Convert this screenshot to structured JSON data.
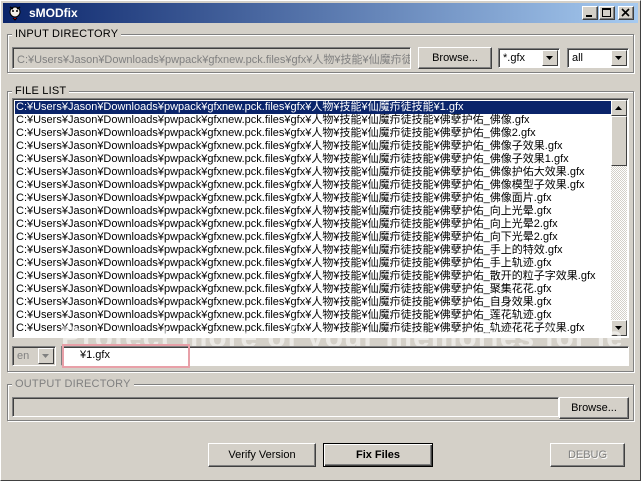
{
  "window": {
    "title": "sMODfix"
  },
  "input_directory": {
    "label": "INPUT DIRECTORY",
    "path": "C:¥Users¥Jason¥Downloads¥pwpack¥gfxnew.pck.files¥gfx¥人物¥技能¥仙魔疖徒技",
    "browse_label": "Browse...",
    "filter_value": "*.gfx",
    "scope_value": "all"
  },
  "file_list": {
    "label": "FILE LIST",
    "items": [
      "C:¥Users¥Jason¥Downloads¥pwpack¥gfxnew.pck.files¥gfx¥人物¥技能¥仙魔疖徒技能¥1.gfx",
      "C:¥Users¥Jason¥Downloads¥pwpack¥gfxnew.pck.files¥gfx¥人物¥技能¥仙魔疖徒技能¥佛孽护佑_佛像.gfx",
      "C:¥Users¥Jason¥Downloads¥pwpack¥gfxnew.pck.files¥gfx¥人物¥技能¥仙魔疖徒技能¥佛孽护佑_佛像2.gfx",
      "C:¥Users¥Jason¥Downloads¥pwpack¥gfxnew.pck.files¥gfx¥人物¥技能¥仙魔疖徒技能¥佛孽护佑_佛像子效果.gfx",
      "C:¥Users¥Jason¥Downloads¥pwpack¥gfxnew.pck.files¥gfx¥人物¥技能¥仙魔疖徒技能¥佛孽护佑_佛像子效果1.gfx",
      "C:¥Users¥Jason¥Downloads¥pwpack¥gfxnew.pck.files¥gfx¥人物¥技能¥仙魔疖徒技能¥佛孽护佑_佛像护佑大效果.gfx",
      "C:¥Users¥Jason¥Downloads¥pwpack¥gfxnew.pck.files¥gfx¥人物¥技能¥仙魔疖徒技能¥佛孽护佑_佛像模型子效果.gfx",
      "C:¥Users¥Jason¥Downloads¥pwpack¥gfxnew.pck.files¥gfx¥人物¥技能¥仙魔疖徒技能¥佛孽护佑_佛像面片.gfx",
      "C:¥Users¥Jason¥Downloads¥pwpack¥gfxnew.pck.files¥gfx¥人物¥技能¥仙魔疖徒技能¥佛孽护佑_向上光晕.gfx",
      "C:¥Users¥Jason¥Downloads¥pwpack¥gfxnew.pck.files¥gfx¥人物¥技能¥仙魔疖徒技能¥佛孽护佑_向上光晕2.gfx",
      "C:¥Users¥Jason¥Downloads¥pwpack¥gfxnew.pck.files¥gfx¥人物¥技能¥仙魔疖徒技能¥佛孽护佑_向下光晕2.gfx",
      "C:¥Users¥Jason¥Downloads¥pwpack¥gfxnew.pck.files¥gfx¥人物¥技能¥仙魔疖徒技能¥佛孽护佑_手上的特效.gfx",
      "C:¥Users¥Jason¥Downloads¥pwpack¥gfxnew.pck.files¥gfx¥人物¥技能¥仙魔疖徒技能¥佛孽护佑_手上轨迹.gfx",
      "C:¥Users¥Jason¥Downloads¥pwpack¥gfxnew.pck.files¥gfx¥人物¥技能¥仙魔疖徒技能¥佛孽护佑_散开的粒子字效果.gfx",
      "C:¥Users¥Jason¥Downloads¥pwpack¥gfxnew.pck.files¥gfx¥人物¥技能¥仙魔疖徒技能¥佛孽护佑_聚集花花.gfx",
      "C:¥Users¥Jason¥Downloads¥pwpack¥gfxnew.pck.files¥gfx¥人物¥技能¥仙魔疖徒技能¥佛孽护佑_自身效果.gfx",
      "C:¥Users¥Jason¥Downloads¥pwpack¥gfxnew.pck.files¥gfx¥人物¥技能¥仙魔疖徒技能¥佛孽护佑_莲花轨迹.gfx",
      "C:¥Users¥Jason¥Downloads¥pwpack¥gfxnew.pck.files¥gfx¥人物¥技能¥仙魔疖徒技能¥佛孽护佑_轨迹花花子效果.gfx"
    ]
  },
  "language_value": "en",
  "filename_value": "¥1.gfx",
  "output_directory": {
    "label": "OUTPUT DIRECTORY",
    "path": "",
    "browse_label": "Browse..."
  },
  "actions": {
    "verify_label": "Verify Version",
    "fix_label": "Fix Files",
    "debug_label": "DEBUG"
  },
  "watermark": "Protect more of your memories for less!",
  "icons": {
    "app": "app-icon",
    "minimize": "minimize-icon",
    "maximize": "maximize-icon",
    "close": "close-icon",
    "dropdown": "chevron-down-icon"
  }
}
